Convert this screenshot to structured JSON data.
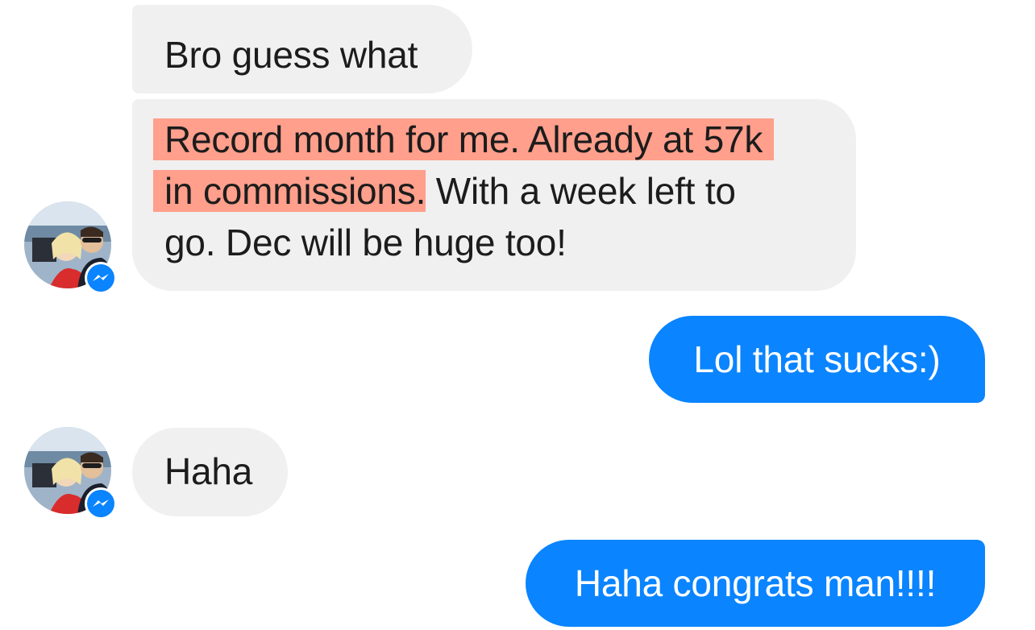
{
  "conversation": {
    "messages": [
      {
        "id": "m1",
        "side": "incoming",
        "text": "Bro guess what"
      },
      {
        "id": "m2",
        "side": "incoming",
        "lines": [
          {
            "highlight": "Record month for me. Already at 57k",
            "rest": ""
          },
          {
            "highlight": "in commissions.",
            "rest": " With a week left to"
          },
          {
            "highlight": "",
            "rest": "go. Dec will be huge too!"
          }
        ],
        "avatar": "contact-avatar",
        "badge_icon": "messenger-icon"
      },
      {
        "id": "m3",
        "side": "outgoing",
        "text": "Lol that sucks:)"
      },
      {
        "id": "m4",
        "side": "incoming",
        "text": "Haha",
        "avatar": "contact-avatar",
        "badge_icon": "messenger-icon"
      },
      {
        "id": "m5",
        "side": "outgoing",
        "text": "Haha congrats man!!!!"
      }
    ]
  },
  "colors": {
    "incoming_bubble": "#f0f0f0",
    "outgoing_bubble": "#0a84ff",
    "highlight": "#ff9f8c",
    "incoming_text": "#1c1c1c",
    "outgoing_text": "#ffffff",
    "messenger_badge": "#0a84ff"
  }
}
